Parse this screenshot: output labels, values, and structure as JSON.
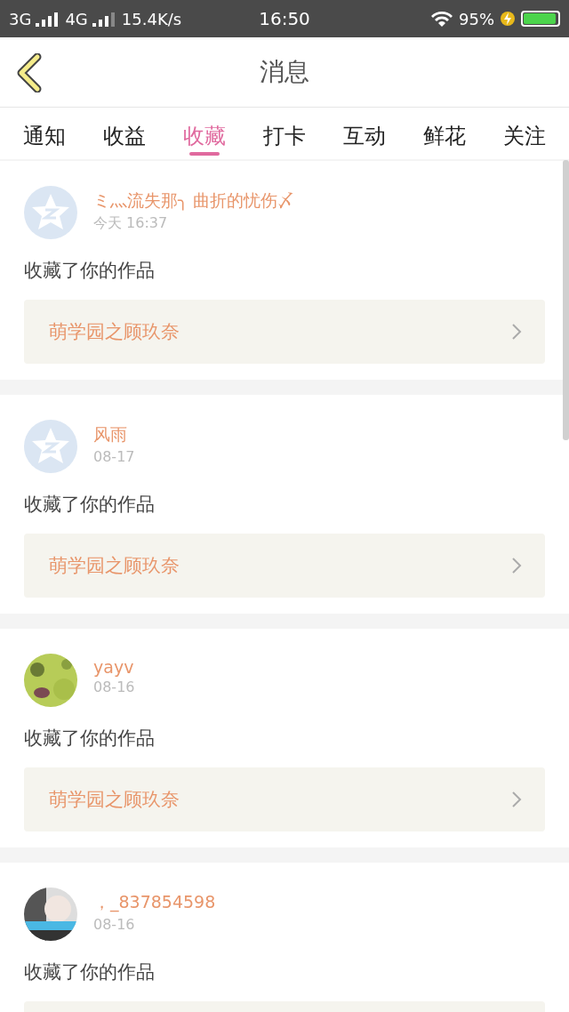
{
  "status_bar": {
    "network_1": "3G",
    "network_2": "4G",
    "speed": "15.4K/s",
    "time": "16:50",
    "battery": "95%",
    "charging": true
  },
  "header": {
    "title": "消息"
  },
  "tabs": [
    {
      "label": "通知",
      "selected": false
    },
    {
      "label": "收益",
      "selected": false
    },
    {
      "label": "收藏",
      "selected": true
    },
    {
      "label": "打卡",
      "selected": false
    },
    {
      "label": "互动",
      "selected": false
    },
    {
      "label": "鲜花",
      "selected": false
    },
    {
      "label": "关注",
      "selected": false
    }
  ],
  "messages": [
    {
      "kind": "default",
      "name": "ミ灬流失那╮ 曲折的忧伤〆",
      "time": "今天 16:37",
      "text": "收藏了你的作品",
      "work": "萌学园之顾玖奈"
    },
    {
      "kind": "default",
      "name": "风雨",
      "time": "08-17",
      "text": "收藏了你的作品",
      "work": "萌学园之顾玖奈"
    },
    {
      "kind": "picture",
      "name": "yayv",
      "time": "08-16",
      "text": "收藏了你的作品",
      "work": "萌学园之顾玖奈"
    },
    {
      "kind": "picture",
      "name": "，_837854598",
      "time": "08-16",
      "text": "收藏了你的作品"
    }
  ]
}
